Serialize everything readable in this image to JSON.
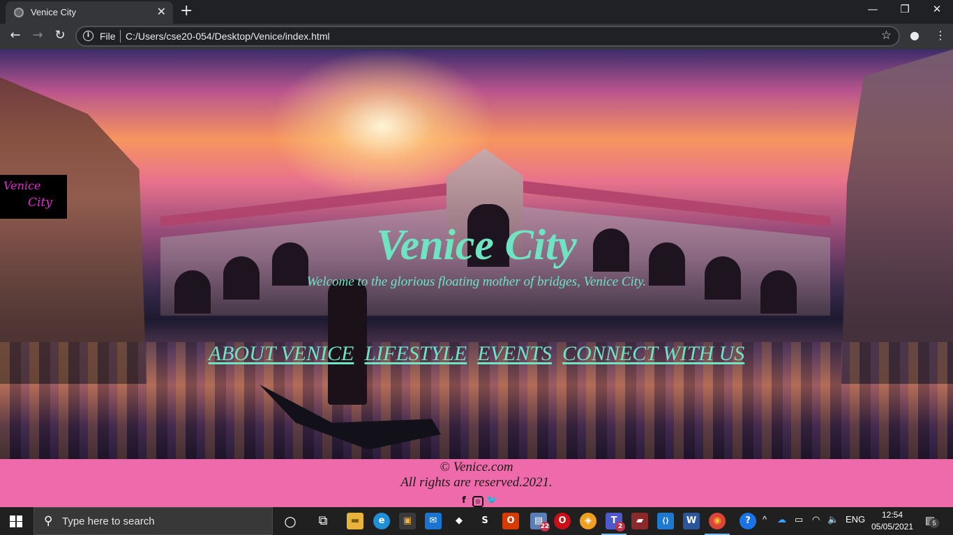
{
  "browser": {
    "tab_title": "Venice City",
    "tab_close": "✕",
    "new_tab": "+",
    "window_controls": {
      "minimize": "—",
      "restore": "❐",
      "close": "✕"
    },
    "back": "←",
    "forward": "→",
    "reload": "↻",
    "info": "i",
    "scheme_label": "File",
    "url": "C:/Users/cse20-054/Desktop/Venice/index.html",
    "star": "☆",
    "profile": "●",
    "menu": "⋮"
  },
  "page": {
    "logo": {
      "line1": "Venice",
      "line2": "City"
    },
    "title": "Venice City",
    "subtitle": "Welcome to the glorious floating mother of bridges, Venice City.",
    "nav": [
      "ABOUT VENICE",
      "LIFESTYLE",
      "EVENTS",
      "CONNECT WITH US"
    ],
    "footer": {
      "copyright": "© Venice.com",
      "rights": "All rights are reserved.2021.",
      "social": [
        {
          "icon": "facebook-icon",
          "glyph": "f"
        },
        {
          "icon": "instagram-icon",
          "glyph": "◎"
        },
        {
          "icon": "twitter-icon",
          "glyph": "🐦"
        }
      ]
    },
    "colors": {
      "accent": "#6ee4c2",
      "footer_bg": "#ef6aaa",
      "logo_text": "#e22bcf"
    }
  },
  "taskbar": {
    "search_placeholder": "Type here to search",
    "apps": [
      {
        "name": "cortana",
        "glyph": "○"
      },
      {
        "name": "task-view",
        "glyph": "⧉"
      },
      {
        "name": "file-explorer",
        "glyph": "▬"
      },
      {
        "name": "edge",
        "glyph": "e"
      },
      {
        "name": "store",
        "glyph": "▣"
      },
      {
        "name": "mail",
        "glyph": "✉"
      },
      {
        "name": "dropbox",
        "glyph": "◆"
      },
      {
        "name": "app-s",
        "glyph": "S"
      },
      {
        "name": "office",
        "glyph": "O"
      },
      {
        "name": "calendar",
        "glyph": "▤",
        "badge": "22"
      },
      {
        "name": "opera",
        "glyph": "O"
      },
      {
        "name": "brave",
        "glyph": "◈"
      },
      {
        "name": "teams",
        "glyph": "T",
        "badge": "2"
      },
      {
        "name": "app-car",
        "glyph": "▰"
      },
      {
        "name": "vscode",
        "glyph": "⟨⟩"
      },
      {
        "name": "word",
        "glyph": "W"
      },
      {
        "name": "chrome",
        "glyph": "◉"
      },
      {
        "name": "help",
        "glyph": "?"
      }
    ],
    "tray": {
      "chevron": "^",
      "lang": "ENG"
    },
    "time": "12:54",
    "date": "05/05/2021",
    "notifications": "5"
  }
}
